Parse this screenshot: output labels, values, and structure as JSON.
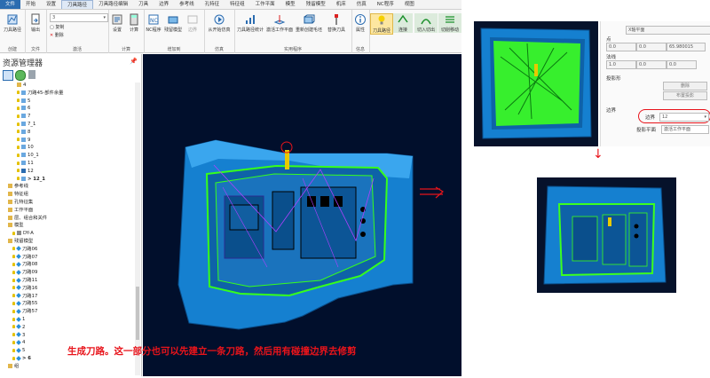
{
  "menu": [
    "文件",
    "开始",
    "设置",
    "刀具路径",
    "刀具路径编辑",
    "刀具",
    "边界",
    "参考线",
    "孔特征",
    "特征组",
    "工作平面",
    "模型",
    "残留模型",
    "机床",
    "仿真",
    "NC程序",
    "视图"
  ],
  "menu_active_index": 3,
  "ribbon": {
    "groups": [
      {
        "label": "创建",
        "buttons": [
          "刀具路径"
        ]
      },
      {
        "label": "文件",
        "buttons": [
          "输出"
        ]
      },
      {
        "label": "激活",
        "combo_value": "3",
        "small": [
          "复制",
          "删除"
        ]
      },
      {
        "label": "计算",
        "buttons": [
          "设置",
          "计算"
        ]
      },
      {
        "label": "增加到",
        "buttons": [
          "NC程序",
          "残留模型",
          "边界"
        ]
      },
      {
        "label": "仿真",
        "buttons": [
          "从开始仿真"
        ]
      },
      {
        "label": "实用程序",
        "buttons": [
          "刀具路径统计",
          "激活工作平面",
          "重新创建毛坯",
          "替换刀具"
        ]
      },
      {
        "label": "信息",
        "buttons": [
          "属性"
        ]
      },
      {
        "label": "",
        "buttons": [
          "刀具路径",
          "连接",
          "切入切出",
          "切削移动"
        ]
      }
    ]
  },
  "explorer": {
    "title": "资源管理器",
    "items": [
      {
        "label": "4",
        "indent": 3,
        "icon": "folder"
      },
      {
        "label": "刀路45-部件余量",
        "indent": 3,
        "icon": "toolpath"
      },
      {
        "label": "5",
        "indent": 3,
        "icon": "toolpath"
      },
      {
        "label": "6",
        "indent": 3,
        "icon": "toolpath"
      },
      {
        "label": "7",
        "indent": 3,
        "icon": "toolpath"
      },
      {
        "label": "7_1",
        "indent": 3,
        "icon": "toolpath"
      },
      {
        "label": "8",
        "indent": 3,
        "icon": "toolpath"
      },
      {
        "label": "9",
        "indent": 3,
        "icon": "toolpath"
      },
      {
        "label": "10",
        "indent": 3,
        "icon": "toolpath"
      },
      {
        "label": "10_1",
        "indent": 3,
        "icon": "toolpath"
      },
      {
        "label": "11",
        "indent": 3,
        "icon": "toolpath"
      },
      {
        "label": "12",
        "indent": 3,
        "icon": "toolpath-selected"
      },
      {
        "label": "> 12_1",
        "indent": 3,
        "icon": "toolpath",
        "bold": true
      },
      {
        "label": "参考线",
        "indent": 1,
        "icon": "folder"
      },
      {
        "label": "特征组",
        "indent": 1,
        "icon": "folder"
      },
      {
        "label": "孔特征集",
        "indent": 1,
        "icon": "folder"
      },
      {
        "label": "工作平面",
        "indent": 1,
        "icon": "folder"
      },
      {
        "label": "层、组合和关件",
        "indent": 1,
        "icon": "folder"
      },
      {
        "label": "模型",
        "indent": 1,
        "icon": "folder"
      },
      {
        "label": "DY-A",
        "indent": 2,
        "icon": "model"
      },
      {
        "label": "残留模型",
        "indent": 1,
        "icon": "folder"
      },
      {
        "label": "刀路06",
        "indent": 2,
        "icon": "stock"
      },
      {
        "label": "刀路07",
        "indent": 2,
        "icon": "stock"
      },
      {
        "label": "刀路08",
        "indent": 2,
        "icon": "stock"
      },
      {
        "label": "刀路09",
        "indent": 2,
        "icon": "stock"
      },
      {
        "label": "刀路11",
        "indent": 2,
        "icon": "stock"
      },
      {
        "label": "刀路16",
        "indent": 2,
        "icon": "stock"
      },
      {
        "label": "刀路17",
        "indent": 2,
        "icon": "stock"
      },
      {
        "label": "刀路55",
        "indent": 2,
        "icon": "stock"
      },
      {
        "label": "刀路57",
        "indent": 2,
        "icon": "stock"
      },
      {
        "label": "1",
        "indent": 2,
        "icon": "stock"
      },
      {
        "label": "2",
        "indent": 2,
        "icon": "stock"
      },
      {
        "label": "3",
        "indent": 2,
        "icon": "stock"
      },
      {
        "label": "4",
        "indent": 2,
        "icon": "stock"
      },
      {
        "label": "5",
        "indent": 2,
        "icon": "stock"
      },
      {
        "label": "> 6",
        "indent": 2,
        "icon": "stock",
        "bold": true
      },
      {
        "label": "组",
        "indent": 1,
        "icon": "folder"
      }
    ]
  },
  "caption": "生成刀路。这一部分也可以先建立一条刀路，然后用有碰撞边界去修剪",
  "props": {
    "header_combo": "X轴平面",
    "point_label": "点",
    "point_values": [
      "0.0",
      "0.0",
      "65.980015"
    ],
    "normal_label": "法线",
    "normal_values": [
      "1.0",
      "0.0",
      "0.0"
    ],
    "projection_label": "投影形",
    "btn_delete": "删除",
    "btn_layout": "布置投影",
    "boundary_section": "边界",
    "boundary_label": "边界",
    "boundary_value": "12",
    "proj_plane_label": "投影平面",
    "proj_plane_value": "激活工作平面"
  },
  "colors": {
    "viewport_bg": "#010f2c",
    "part_blue": "#1a8fd8",
    "toolpath_green": "#3cff1f",
    "highlight_red": "#e8141b",
    "menu_active": "#2b6cb0"
  }
}
